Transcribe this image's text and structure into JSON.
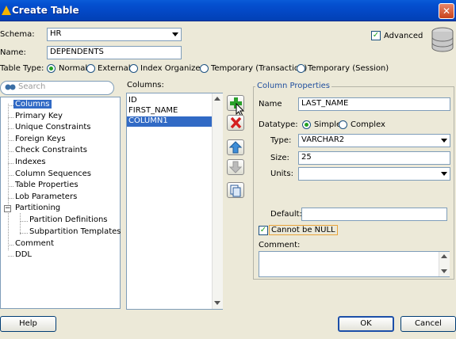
{
  "window": {
    "title": "Create Table"
  },
  "schema": {
    "label": "Schema:",
    "value": "HR"
  },
  "name": {
    "label": "Name:",
    "value": "DEPENDENTS"
  },
  "advanced": {
    "label": "Advanced",
    "checked": true
  },
  "table_type": {
    "label": "Table Type:",
    "options": [
      "Normal",
      "External",
      "Index Organized",
      "Temporary (Transaction)",
      "Temporary (Session)"
    ],
    "selected": "Normal"
  },
  "search": {
    "placeholder": "Search"
  },
  "tree": {
    "items": [
      "Columns",
      "Primary Key",
      "Unique Constraints",
      "Foreign Keys",
      "Check Constraints",
      "Indexes",
      "Column Sequences",
      "Table Properties",
      "Lob Parameters",
      "Partitioning",
      "Partition Definitions",
      "Subpartition Templates",
      "Comment",
      "DDL"
    ],
    "selected": "Columns"
  },
  "columns": {
    "label": "Columns:",
    "items": [
      "ID",
      "FIRST_NAME",
      "COLUMN1"
    ],
    "selected": "COLUMN1"
  },
  "properties": {
    "title": "Column Properties",
    "name_label": "Name",
    "name_value": "LAST_NAME",
    "datatype_label": "Datatype:",
    "datatype_options": [
      "Simple",
      "Complex"
    ],
    "datatype_selected": "Simple",
    "type_label": "Type:",
    "type_value": "VARCHAR2",
    "size_label": "Size:",
    "size_value": "25",
    "units_label": "Units:",
    "units_value": "",
    "default_label": "Default:",
    "default_value": "",
    "not_null_label": "Cannot be NULL",
    "not_null_checked": true,
    "comment_label": "Comment:",
    "comment_value": ""
  },
  "buttons": {
    "help": "Help",
    "ok": "OK",
    "cancel": "Cancel"
  },
  "colors": {
    "titlebar": "#0347c4",
    "selection": "#316ac5",
    "add": "#2aa02a",
    "remove": "#d42020"
  }
}
